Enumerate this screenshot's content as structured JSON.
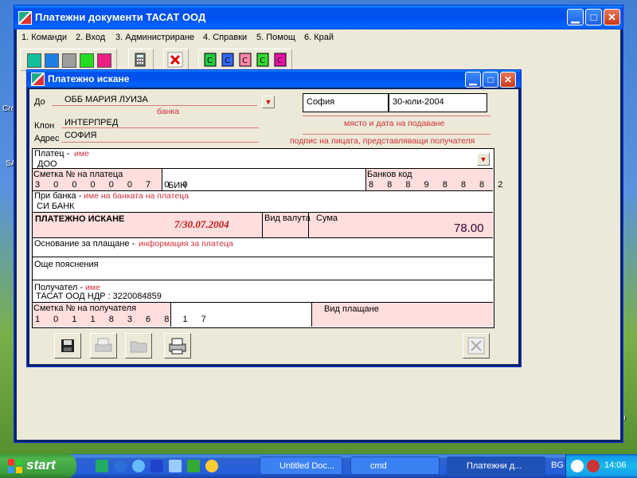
{
  "desktop": {
    "labels": [
      "Cre",
      "SA",
      "n"
    ]
  },
  "app": {
    "title": "Платежни документи  ТАСАТ ООД",
    "menu": [
      "1. Команди",
      "2. Вход",
      "3. Администриране",
      "4. Справки",
      "5. Помощ",
      "6. Край"
    ],
    "toolbar_colors": [
      "#11bf9b",
      "#1e7ee8",
      "#9e9e9e",
      "#22dd22",
      "#ee1e82"
    ],
    "toolbar_icons": [
      "calculator-icon",
      "delete-x-icon",
      "document-green-icon",
      "document-blue-icon",
      "document-pink-icon",
      "document-green-icon",
      "document-magenta-icon"
    ]
  },
  "dialog": {
    "title": "Платежно искане",
    "do_label": "До",
    "do_value": "ОББ МАРИЯ ЛУИЗА",
    "banka_hint": "банка",
    "klon_label": "Клон",
    "klon_value": "ИНТЕРПРЕД",
    "adres_label": "Адрес",
    "adres_value": "СОФИЯ",
    "place": "София",
    "date": "30-юли-2004",
    "place_date_hint": "място  и дата на подаване",
    "signature_hint": "подпис на лицата, представляващи получателя",
    "payer_label": "Платец -",
    "payer_hint": "име",
    "payer_value": "ДОО",
    "payer_account_label": "Сметка № на платеца",
    "payer_account_value": "3 0 0 0 0 0 7 0 0",
    "bin_label": "БИН",
    "bank_code_label": "Банков код",
    "bank_code_value": "8 8 8 9 8 8 8 2",
    "at_bank_label": "При банка -",
    "at_bank_hint": "име на банката на платеца",
    "at_bank_value": "СИ БАНК",
    "doc_type": "ПЛАТЕЖНО ИСКАНЕ",
    "doc_number": "7/30.07.2004",
    "currency_label": "Вид валута",
    "amount_label": "Сума",
    "amount_value": "78.00",
    "basis_label": "Основание за плащане -",
    "basis_hint": "информация за платеца",
    "more_label": "Още пояснения",
    "recipient_label": "Получател -",
    "recipient_hint": "име",
    "recipient_value": "ТАСАТ ООД   НДР : 3220084859",
    "recipient_account_label": "Сметка № на получателя",
    "recipient_account_value": "1 0 1 1 8 3 6 8 1 7",
    "payment_type_label": "Вид плащане"
  },
  "taskbar": {
    "start": "start",
    "tasks": [
      "Untitled Doc...",
      "cmd",
      "Платежни д..."
    ],
    "lang": "BG",
    "clock": "14:06"
  }
}
